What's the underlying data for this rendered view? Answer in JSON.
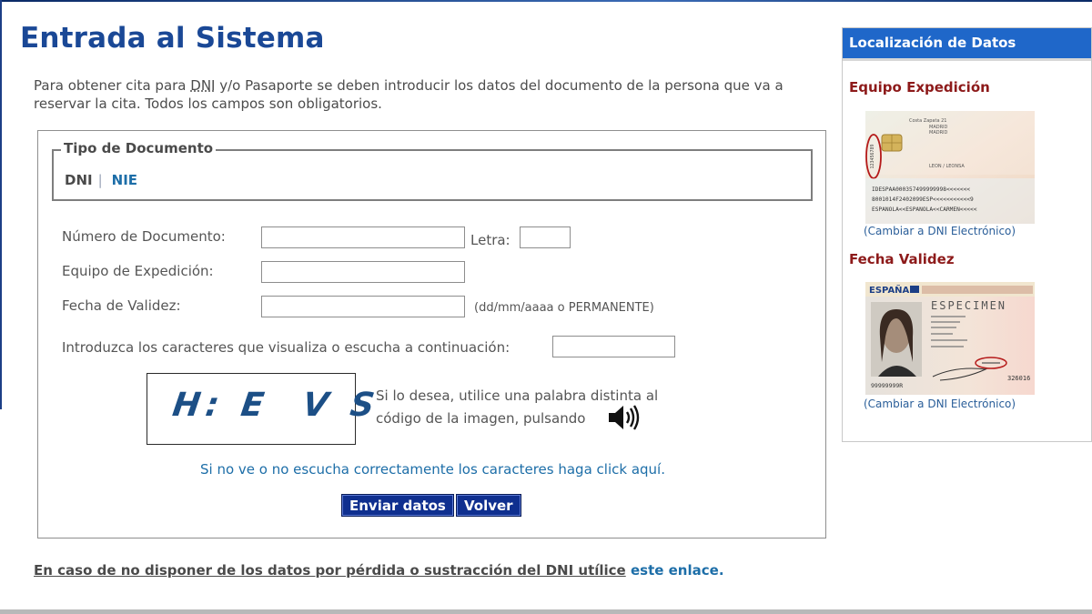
{
  "page": {
    "title": "Entrada al Sistema",
    "intro_part1": "Para obtener cita para ",
    "intro_dni": "DNI",
    "intro_part2": " y/o Pasaporte se deben introducir los datos del documento de la persona que va a reservar la cita. Todos los campos son obligatorios."
  },
  "doc_type": {
    "legend": "Tipo de Documento",
    "dni": "DNI",
    "separator": "|",
    "nie": "NIE"
  },
  "form": {
    "numero_label": "Número de Documento:",
    "numero_value": "",
    "letra_label": "Letra:",
    "letra_value": "",
    "equipo_label": "Equipo de Expedición:",
    "equipo_value": "",
    "fecha_label": "Fecha de Validez:",
    "fecha_value": "",
    "fecha_hint": "(dd/mm/aaaa o PERMANENTE)",
    "captcha_label": "Introduzca los caracteres que visualiza o escucha a continuación:",
    "captcha_value": "",
    "captcha_image_text": "H: E  V S",
    "audio_text": "Si lo desea, utilice una palabra distinta al código de la imagen, pulsando",
    "help_link": "Si no ve o no escucha correctamente los caracteres haga click aquí.",
    "submit": "Enviar datos",
    "back": "Volver"
  },
  "footer": {
    "text": "En caso de no disponer de los datos por pérdida o sustracción del DNI utílice",
    "link": "este enlace."
  },
  "sidebar": {
    "header": "Localización de Datos",
    "equipo_title": "Equipo Expedición",
    "fecha_title": "Fecha Validez",
    "change_link_1": "(Cambiar a DNI Electrónico)",
    "change_link_2": "(Cambiar a DNI Electrónico)",
    "card_back": {
      "top_lines": [
        "Costa Zapata 21",
        "MADRID",
        "MADRID",
        "LEON / LEONSA"
      ],
      "mrz": [
        "IDESPAA000357499999998<<<<<<<",
        "8001014F2402099ESP<<<<<<<<<<<9",
        "ESPANOLA<<ESPANOLA<<CARMEN<<<<<"
      ],
      "side_code": "123456789"
    },
    "card_front": {
      "country": "ESPAÑA",
      "specimen": "ESPECIMEN",
      "number": "99999999R",
      "code": "326016"
    }
  },
  "colors": {
    "title": "#1a4896",
    "link": "#1d6ea8",
    "button": "#0f2f8f",
    "sidebar_header": "#1f67c9",
    "sidebar_subtitle": "#8d1a1a"
  }
}
